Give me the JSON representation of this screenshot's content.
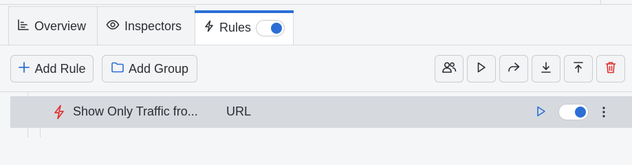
{
  "tabs": [
    {
      "label": "Overview",
      "icon": "bar-chart-icon"
    },
    {
      "label": "Inspectors",
      "icon": "eye-icon"
    },
    {
      "label": "Rules",
      "icon": "bolt-icon",
      "active": true,
      "toggle_on": true
    }
  ],
  "toolbar": {
    "add_rule_label": "Add Rule",
    "add_group_label": "Add Group",
    "icon_buttons": [
      "users-icon",
      "play-icon",
      "share-icon",
      "download-icon",
      "upload-icon",
      "trash-icon"
    ]
  },
  "rules": [
    {
      "name": "Show Only Traffic fro...",
      "type": "URL",
      "enabled": true
    }
  ],
  "colors": {
    "accent": "#2b6fd6",
    "danger": "#e03131",
    "row_bg": "#d6dadf"
  }
}
